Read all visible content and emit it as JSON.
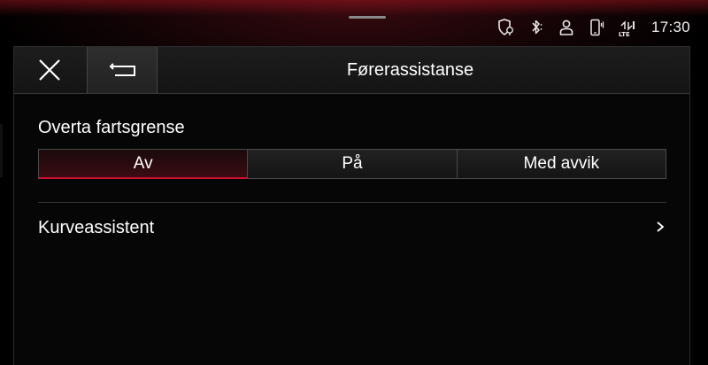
{
  "status_bar": {
    "time": "17:30",
    "icons": [
      "location-shield-icon",
      "bluetooth-icon",
      "user-profile-icon",
      "phone-icon",
      "lte-signal-icon"
    ],
    "lte_label": "LTE"
  },
  "header": {
    "title": "Førerassistanse",
    "close_icon": "close-icon",
    "back_icon": "back-arrow-icon"
  },
  "speed_limit_section": {
    "label": "Overta fartsgrense",
    "options": [
      {
        "label": "Av",
        "selected": true
      },
      {
        "label": "På",
        "selected": false
      },
      {
        "label": "Med avvik",
        "selected": false
      }
    ]
  },
  "list": {
    "items": [
      {
        "label": "Kurveassistent",
        "chevron": ">"
      }
    ]
  },
  "colors": {
    "accent": "#c8102e",
    "background": "#000000",
    "text": "#ffffff"
  }
}
